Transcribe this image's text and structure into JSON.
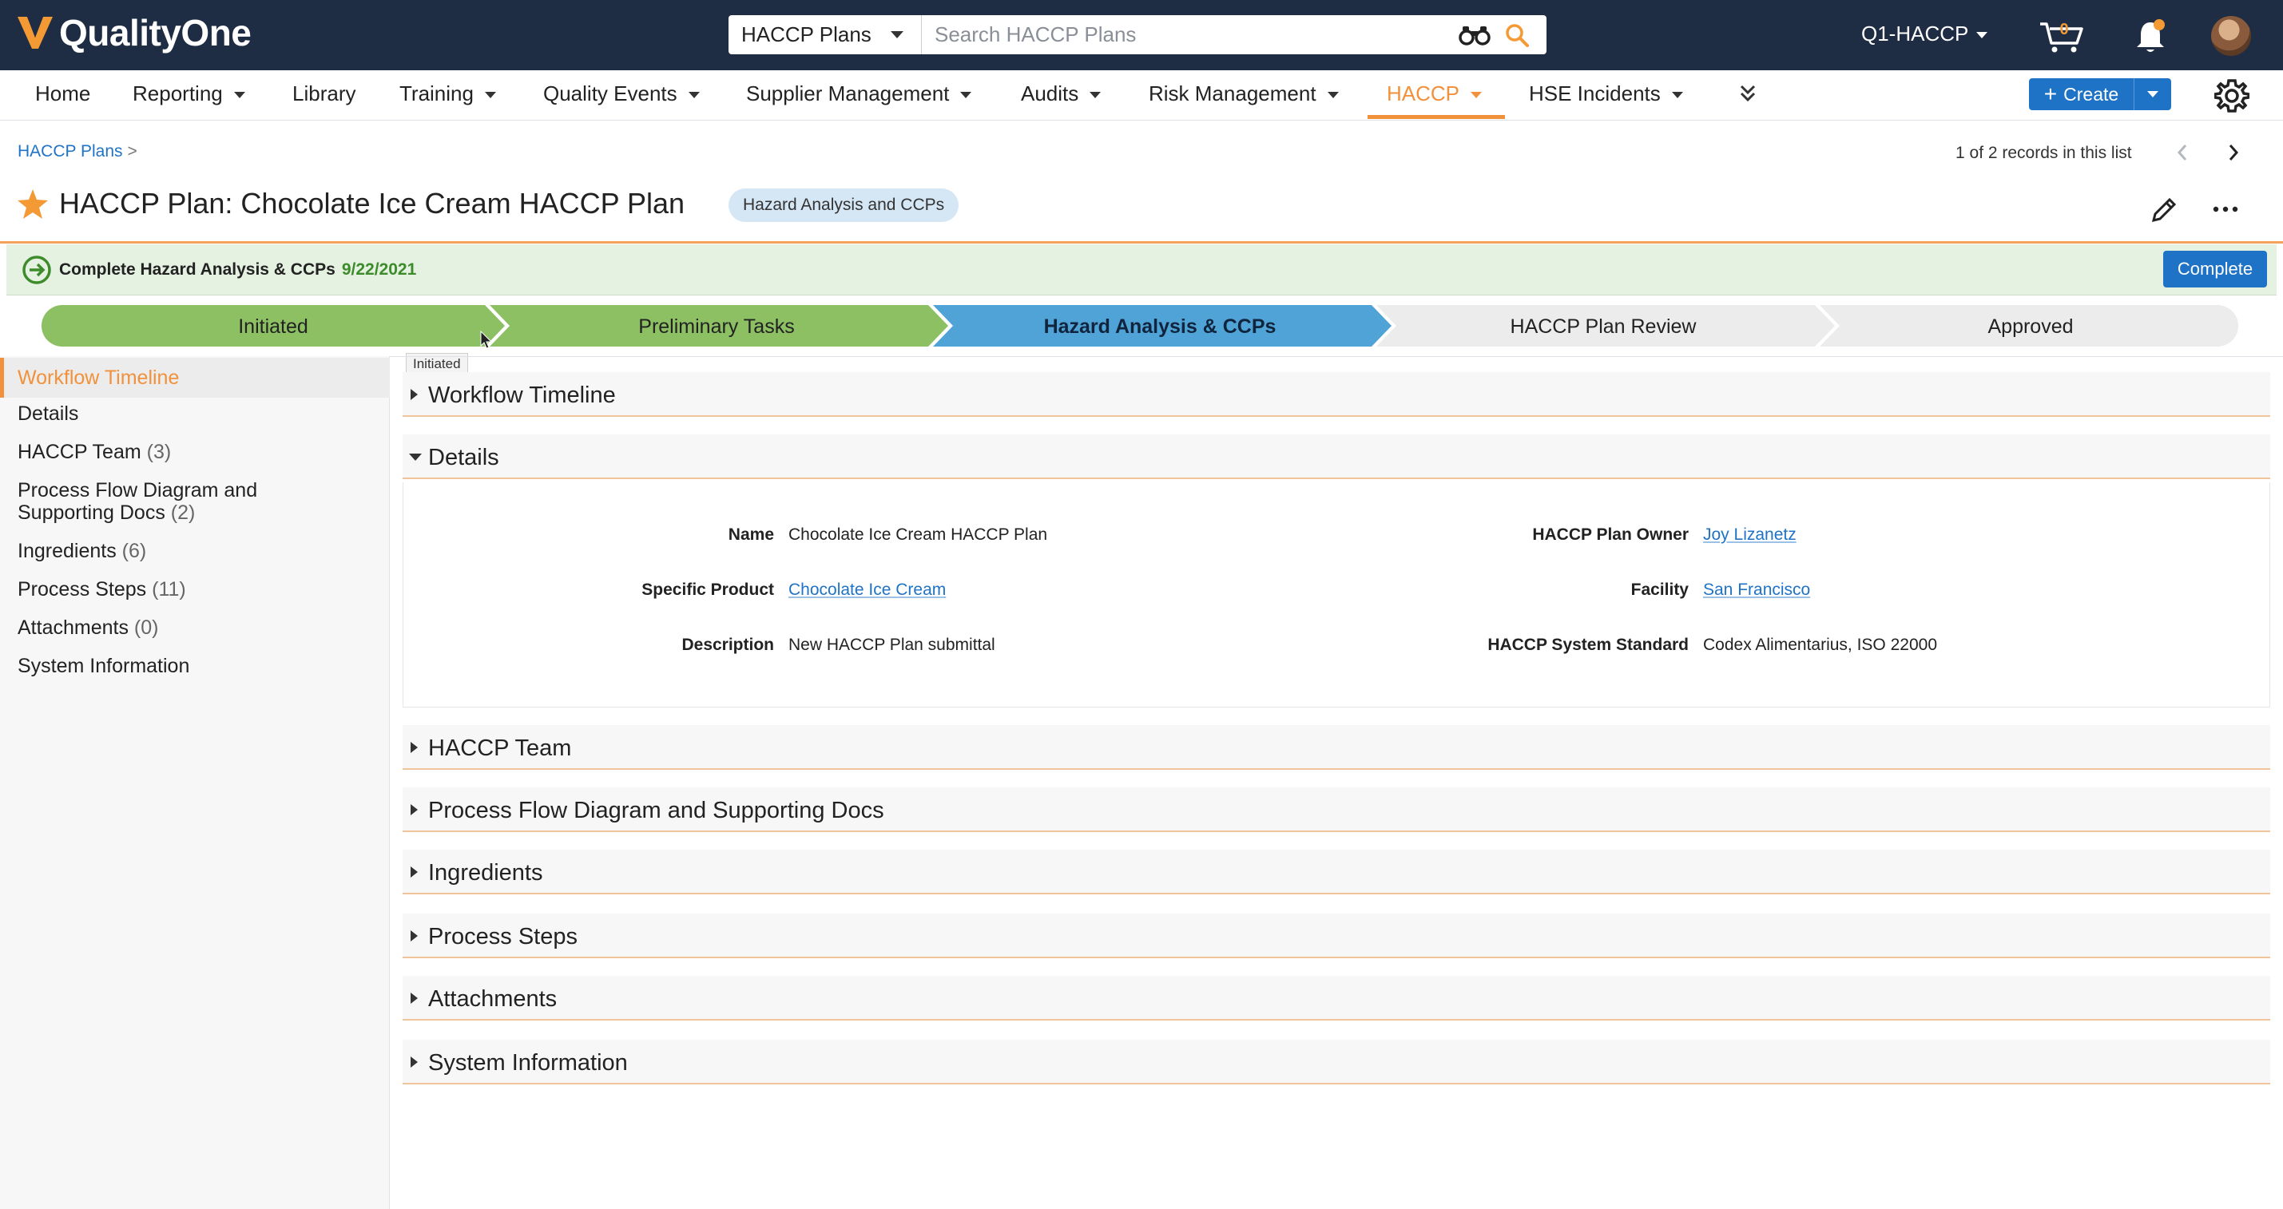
{
  "app": {
    "brand": "QualityOne",
    "search_scope": "HACCP Plans",
    "search_placeholder": "Search HACCP Plans",
    "site": "Q1-HACCP",
    "cart_count": "0"
  },
  "nav": {
    "items": [
      "Home",
      "Reporting",
      "Library",
      "Training",
      "Quality Events",
      "Supplier Management",
      "Audits",
      "Risk Management",
      "HACCP",
      "HSE Incidents"
    ],
    "active": "HACCP",
    "create_label": "Create"
  },
  "header": {
    "breadcrumb": "HACCP Plans",
    "breadcrumb_sep": ">",
    "records": "1 of 2 records in this list",
    "title": "HACCP Plan: Chocolate Ice Cream HACCP Plan",
    "stage_badge": "Hazard Analysis and CCPs"
  },
  "banner": {
    "text": "Complete Hazard Analysis & CCPs",
    "date": "9/22/2021",
    "complete_label": "Complete"
  },
  "workflow": {
    "stages": [
      "Initiated",
      "Preliminary Tasks",
      "Hazard Analysis & CCPs",
      "HACCP Plan Review",
      "Approved"
    ],
    "current_index": 2,
    "tooltip": "Initiated",
    "colors": {
      "done": "#8cc063",
      "current": "#4fa3d6",
      "pending": "#ececec"
    }
  },
  "sidebar": {
    "items": [
      {
        "label": "Workflow Timeline",
        "count": ""
      },
      {
        "label": "Details",
        "count": ""
      },
      {
        "label": "HACCP Team",
        "count": "(3)"
      },
      {
        "label": "Process Flow Diagram and",
        "label2": "Supporting Docs",
        "count": "(2)"
      },
      {
        "label": "Ingredients",
        "count": "(6)"
      },
      {
        "label": "Process Steps",
        "count": "(11)"
      },
      {
        "label": "Attachments",
        "count": "(0)"
      },
      {
        "label": "System Information",
        "count": ""
      }
    ]
  },
  "sections": [
    "Workflow Timeline",
    "Details",
    "HACCP Team",
    "Process Flow Diagram and Supporting Docs",
    "Ingredients",
    "Process Steps",
    "Attachments",
    "System Information"
  ],
  "details": {
    "name_label": "Name",
    "name": "Chocolate Ice Cream HACCP Plan",
    "product_label": "Specific Product",
    "product": "Chocolate Ice Cream",
    "description_label": "Description",
    "description": "New HACCP Plan submittal",
    "owner_label": "HACCP Plan Owner",
    "owner": "Joy Lizanetz",
    "facility_label": "Facility",
    "facility": "San Francisco",
    "standard_label": "HACCP System Standard",
    "standard": "Codex Alimentarius, ISO 22000"
  },
  "icons": {
    "binoculars": "binoculars-icon",
    "search": "search-icon",
    "cart": "cart-icon",
    "bell": "bell-icon",
    "gear": "gear-icon",
    "star": "star-icon",
    "edit": "pencil-icon",
    "more": "more-icon"
  },
  "colors": {
    "accent": "#f2913b",
    "primary": "#1f73c6",
    "topbar": "#1f2d44"
  }
}
